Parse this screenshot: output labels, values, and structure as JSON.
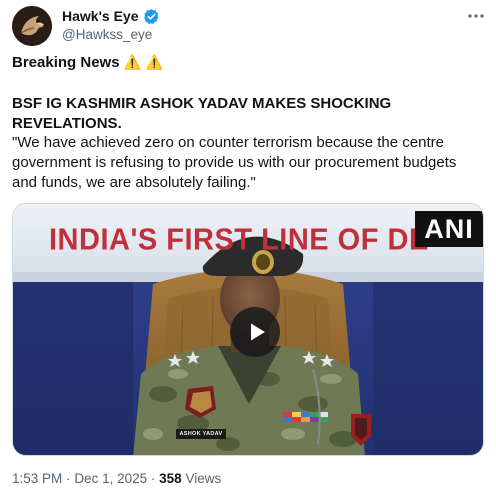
{
  "author": {
    "display_name": "Hawk's Eye",
    "handle": "@Hawkss_eye",
    "verified": true,
    "avatar_icon": "hawk-logo-icon"
  },
  "more_icon": "more-horizontal-icon",
  "content": {
    "breaking": "Breaking News",
    "breaking_emoji": "⚠️ ⚠️",
    "headline": "BSF IG KASHMIR ASHOK YADAV MAKES SHOCKING REVELATIONS.",
    "quote": "\"We have achieved zero on counter terrorism because the centre government is refusing to provide us with our procurement budgets and funds, we are absolutely failing.\""
  },
  "media": {
    "banner_text": "INDIA'S FIRST LINE OF DE",
    "watermark": "ANI",
    "name_tag": "ASHOK YADAV",
    "play_icon": "play-icon"
  },
  "footer": {
    "time": "1:53 PM",
    "separator": "·",
    "date": "Dec 1, 2025",
    "views_count": "358",
    "views_label": "Views"
  },
  "colors": {
    "verified": "#1d9bf0",
    "secondary_text": "#536471",
    "banner_red": "#c0303a"
  }
}
